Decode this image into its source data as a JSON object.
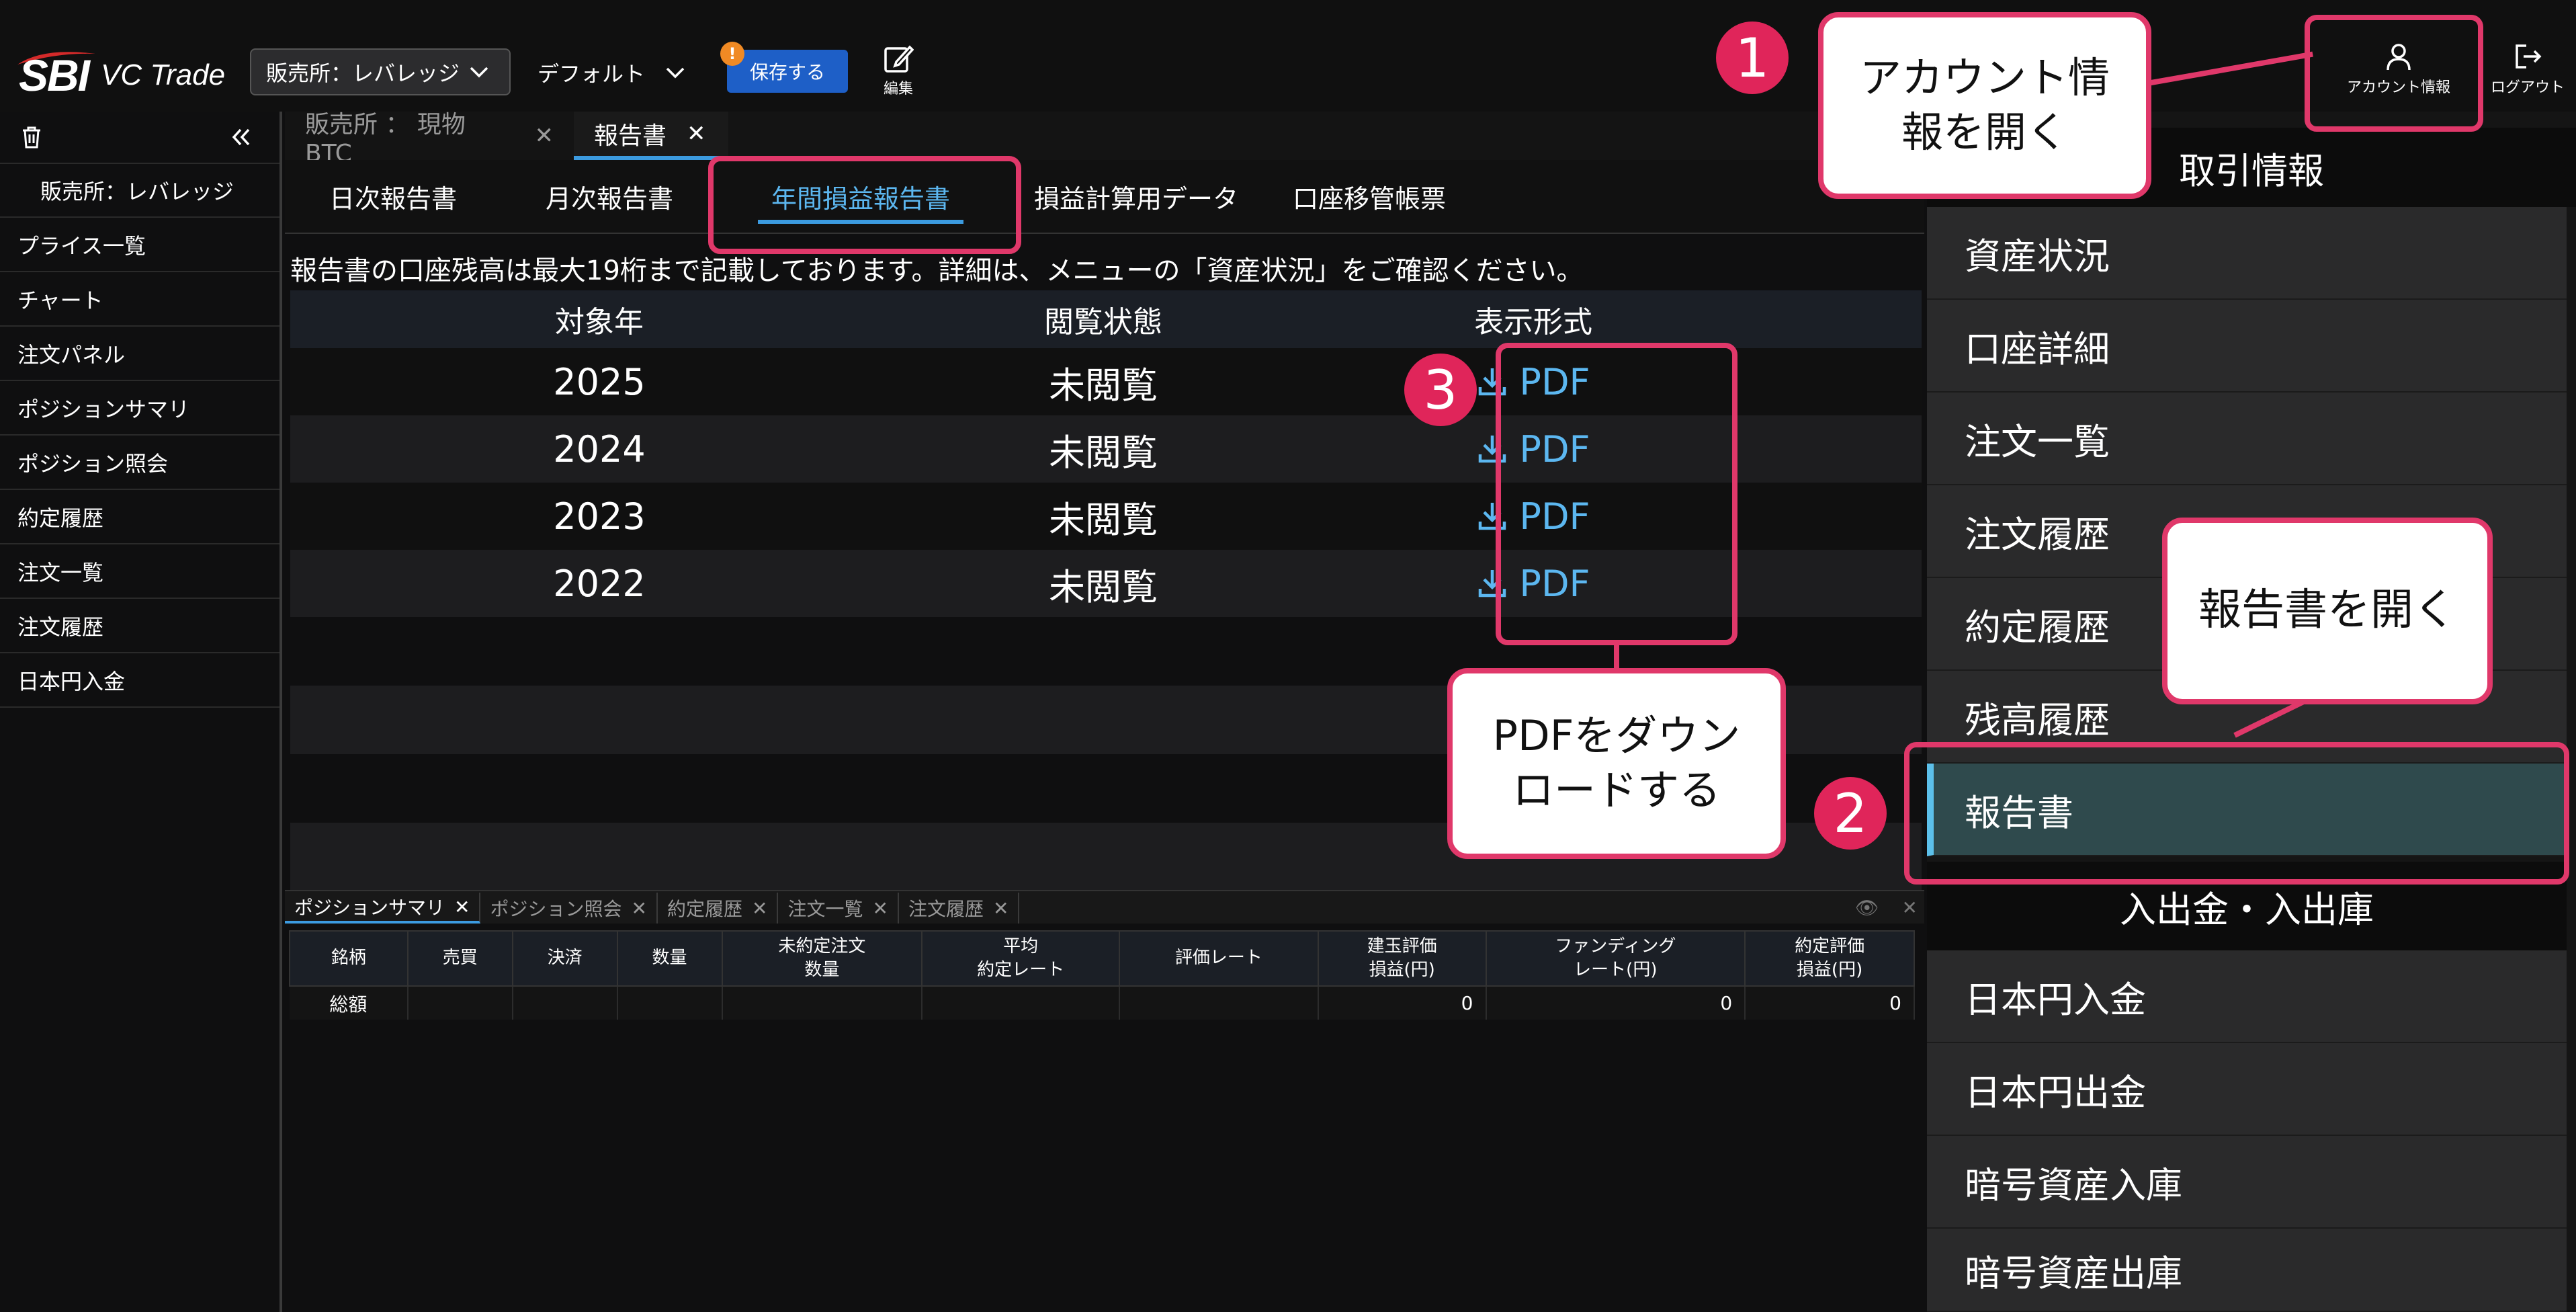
{
  "header": {
    "logo_sbi": "SBI",
    "logo_vc": "VC Trade",
    "exchange_select": "販売所：レバレッジ",
    "layout_select": "デフォルト",
    "save_badge": "!",
    "save_label": "保存する",
    "edit_label": "編集",
    "account_label": "アカウント情報",
    "logout_label": "ログアウト"
  },
  "sidebar": {
    "exchange_label": "販売所：レバレッジ",
    "items": [
      {
        "label": "プライス一覧"
      },
      {
        "label": "チャート"
      },
      {
        "label": "注文パネル"
      },
      {
        "label": "ポジションサマリ"
      },
      {
        "label": "ポジション照会"
      },
      {
        "label": "約定履歴"
      },
      {
        "label": "注文一覧"
      },
      {
        "label": "注文履歴"
      },
      {
        "label": "日本円入金"
      }
    ]
  },
  "main": {
    "doc_tabs": [
      {
        "label": "販売所 ： 現物 BTC"
      },
      {
        "label": "報告書"
      }
    ],
    "sub_tabs": [
      {
        "label": "日次報告書"
      },
      {
        "label": "月次報告書"
      },
      {
        "label": "年間損益報告書"
      },
      {
        "label": "損益計算用データ"
      },
      {
        "label": "口座移管帳票"
      }
    ],
    "notice": "報告書の口座残高は最大19桁まで記載しております。詳細は、メニューの「資産状況」をご確認ください。",
    "table": {
      "headers": {
        "year": "対象年",
        "status": "閲覧状態",
        "format": "表示形式"
      },
      "rows": [
        {
          "year": "2025",
          "status": "未閲覧",
          "format": "PDF"
        },
        {
          "year": "2024",
          "status": "未閲覧",
          "format": "PDF"
        },
        {
          "year": "2023",
          "status": "未閲覧",
          "format": "PDF"
        },
        {
          "year": "2022",
          "status": "未閲覧",
          "format": "PDF"
        }
      ]
    }
  },
  "bottom_panel": {
    "tabs": [
      {
        "label": "ポジションサマリ"
      },
      {
        "label": "ポジション照会"
      },
      {
        "label": "約定履歴"
      },
      {
        "label": "注文一覧"
      },
      {
        "label": "注文履歴"
      }
    ],
    "columns": [
      {
        "line1": "銘柄",
        "line2": ""
      },
      {
        "line1": "売買",
        "line2": ""
      },
      {
        "line1": "決済",
        "line2": ""
      },
      {
        "line1": "数量",
        "line2": ""
      },
      {
        "line1": "未約定注文",
        "line2": "数量"
      },
      {
        "line1": "平均",
        "line2": "約定レート"
      },
      {
        "line1": "評価レート",
        "line2": ""
      },
      {
        "line1": "建玉評価",
        "line2": "損益(円)"
      },
      {
        "line1": "ファンディング",
        "line2": "レート(円)"
      },
      {
        "line1": "約定評価",
        "line2": "損益(円)"
      }
    ],
    "total_row": {
      "label": "総額",
      "pnl": "0",
      "funding": "0",
      "exec_pnl": "0"
    }
  },
  "account_menu": {
    "section_trade": "取引情報",
    "items": [
      {
        "label": "資産状況"
      },
      {
        "label": "口座詳細"
      },
      {
        "label": "注文一覧"
      },
      {
        "label": "注文履歴"
      },
      {
        "label": "約定履歴"
      },
      {
        "label": "残高履歴"
      },
      {
        "label": "報告書"
      }
    ],
    "section_deposit": "入出金・入出庫",
    "deposit_items": [
      {
        "label": "日本円入金"
      },
      {
        "label": "日本円出金"
      },
      {
        "label": "暗号資産入庫"
      },
      {
        "label": "暗号資産出庫"
      }
    ]
  },
  "annotations": {
    "step1": "1",
    "step2": "2",
    "step3": "3",
    "callout1_line1": "アカウント情",
    "callout1_line2": "報を開く",
    "callout2": "報告書を開く",
    "callout3_line1": "PDFをダウン",
    "callout3_line2": "ロードする"
  },
  "colors": {
    "accent_blue": "#3c9be0",
    "annotation_pink": "#e0386a",
    "save_button": "#1e5fc7",
    "active_menu": "#2f4a4d"
  }
}
